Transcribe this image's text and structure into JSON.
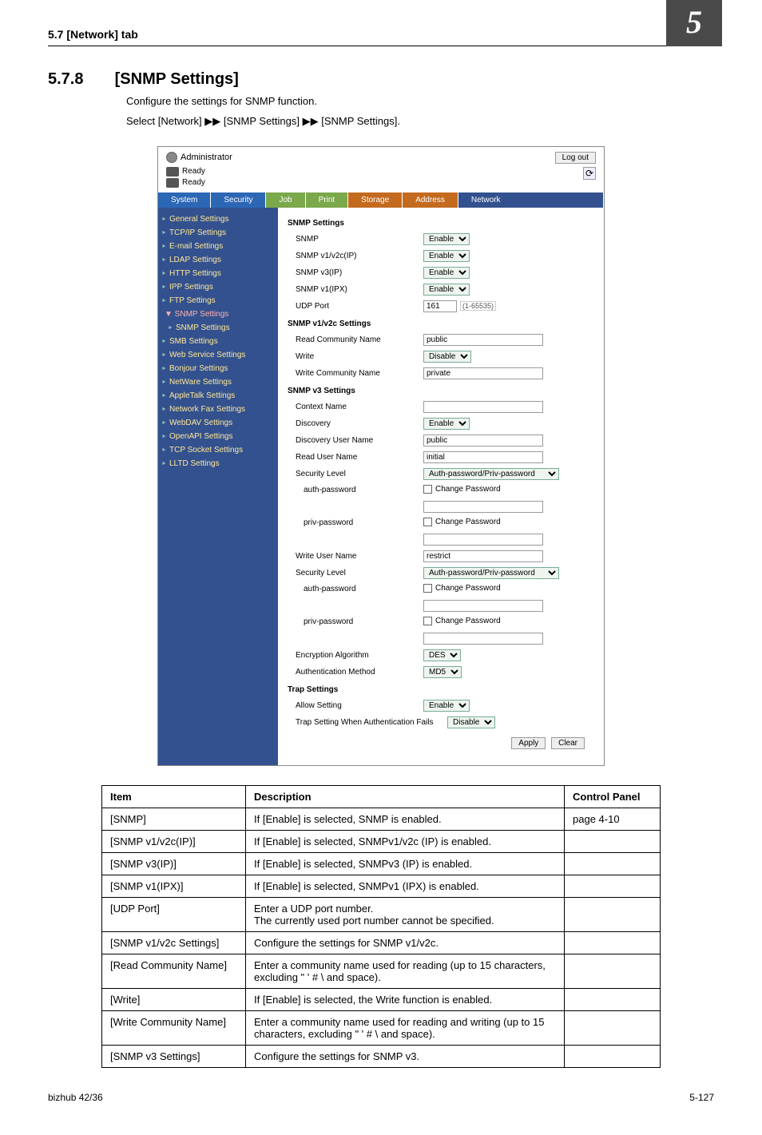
{
  "header": {
    "left": "5.7    [Network] tab",
    "right_num": "5"
  },
  "heading": {
    "num": "5.7.8",
    "title": "[SNMP Settings]"
  },
  "intro": {
    "line1": "Configure the settings for SNMP function.",
    "line2": "Select [Network] ▶▶ [SNMP Settings] ▶▶ [SNMP Settings]."
  },
  "shot": {
    "admin_label": "Administrator",
    "logout": "Log out",
    "ready": "Ready",
    "tabs": {
      "system": "System",
      "security": "Security",
      "job": "Job",
      "print": "Print",
      "storage": "Storage",
      "address": "Address",
      "network": "Network"
    },
    "sidebar": {
      "general": "General Settings",
      "tcpip": "TCP/IP Settings",
      "email": "E-mail Settings",
      "ldap": "LDAP Settings",
      "http": "HTTP Settings",
      "ipp": "IPP Settings",
      "ftp": "FTP Settings",
      "snmp_head": "▼ SNMP Settings",
      "snmp_sub": "SNMP Settings",
      "smb": "SMB Settings",
      "web": "Web Service Settings",
      "bonjour": "Bonjour Settings",
      "netware": "NetWare Settings",
      "appletalk": "AppleTalk Settings",
      "netfax": "Network Fax Settings",
      "webdav": "WebDAV Settings",
      "openapi": "OpenAPI Settings",
      "tcpsock": "TCP Socket Settings",
      "lltd": "LLTD Settings"
    },
    "content": {
      "grp_snmp": "SNMP Settings",
      "snmp": {
        "lbl": "SNMP",
        "val": "Enable"
      },
      "v1v2cip": {
        "lbl": "SNMP v1/v2c(IP)",
        "val": "Enable"
      },
      "v3ip": {
        "lbl": "SNMP v3(IP)",
        "val": "Enable"
      },
      "v1ipx": {
        "lbl": "SNMP v1(IPX)",
        "val": "Enable"
      },
      "udp": {
        "lbl": "UDP Port",
        "val": "161",
        "hint": "(1-65535)"
      },
      "grp_v1v2": "SNMP v1/v2c Settings",
      "rcn": {
        "lbl": "Read Community Name",
        "val": "public"
      },
      "write": {
        "lbl": "Write",
        "val": "Disable"
      },
      "wcn": {
        "lbl": "Write Community Name",
        "val": "private"
      },
      "grp_v3": "SNMP v3 Settings",
      "ctx": {
        "lbl": "Context Name",
        "val": ""
      },
      "disc": {
        "lbl": "Discovery",
        "val": "Enable"
      },
      "dun": {
        "lbl": "Discovery User Name",
        "val": "public"
      },
      "run": {
        "lbl": "Read User Name",
        "val": "initial"
      },
      "seclvl": {
        "lbl": "Security Level",
        "val": "Auth-password/Priv-password"
      },
      "authpw": {
        "lbl": "auth-password",
        "chk": "Change Password"
      },
      "privpw": {
        "lbl": "priv-password",
        "chk": "Change Password"
      },
      "wun": {
        "lbl": "Write User Name",
        "val": "restrict"
      },
      "seclvl2": {
        "lbl": "Security Level",
        "val": "Auth-password/Priv-password"
      },
      "authpw2": {
        "lbl": "auth-password",
        "chk": "Change Password"
      },
      "privpw2": {
        "lbl": "priv-password",
        "chk": "Change Password"
      },
      "encalg": {
        "lbl": "Encryption Algorithm",
        "val": "DES"
      },
      "authm": {
        "lbl": "Authentication Method",
        "val": "MD5"
      },
      "grp_trap": "Trap Settings",
      "allow": {
        "lbl": "Allow Setting",
        "val": "Enable"
      },
      "trapfail": {
        "lbl": "Trap Setting When Authentication Fails",
        "val": "Disable"
      },
      "apply": "Apply",
      "clear": "Clear"
    }
  },
  "table": {
    "head": {
      "item": "Item",
      "desc": "Description",
      "cp": "Control Panel"
    },
    "rows": [
      {
        "item": "[SNMP]",
        "desc": "If [Enable] is selected, SNMP is enabled.",
        "cp": "page 4-10"
      },
      {
        "item": "[SNMP v1/v2c(IP)]",
        "desc": "If [Enable] is selected, SNMPv1/v2c (IP) is enabled.",
        "cp": ""
      },
      {
        "item": "[SNMP v3(IP)]",
        "desc": "If [Enable] is selected, SNMPv3 (IP) is enabled.",
        "cp": ""
      },
      {
        "item": "[SNMP v1(IPX)]",
        "desc": "If [Enable] is selected, SNMPv1 (IPX) is enabled.",
        "cp": ""
      },
      {
        "item": "[UDP Port]",
        "desc": "Enter a UDP port number.\nThe currently used port number cannot be specified.",
        "cp": ""
      },
      {
        "item": "[SNMP v1/v2c Settings]",
        "desc": "Configure the settings for SNMP v1/v2c.",
        "cp": ""
      },
      {
        "item": "[Read Community Name]",
        "desc": "Enter a community name used for reading (up to 15 characters, excluding \" ' # \\ and space).",
        "cp": ""
      },
      {
        "item": "[Write]",
        "desc": "If [Enable] is selected, the Write function is enabled.",
        "cp": ""
      },
      {
        "item": "[Write Community Name]",
        "desc": "Enter a community name used for reading and writing (up to 15 characters, excluding \" ' # \\ and space).",
        "cp": ""
      },
      {
        "item": "[SNMP v3 Settings]",
        "desc": "Configure the settings for SNMP v3.",
        "cp": ""
      }
    ]
  },
  "footer": {
    "left": "bizhub 42/36",
    "right": "5-127"
  }
}
